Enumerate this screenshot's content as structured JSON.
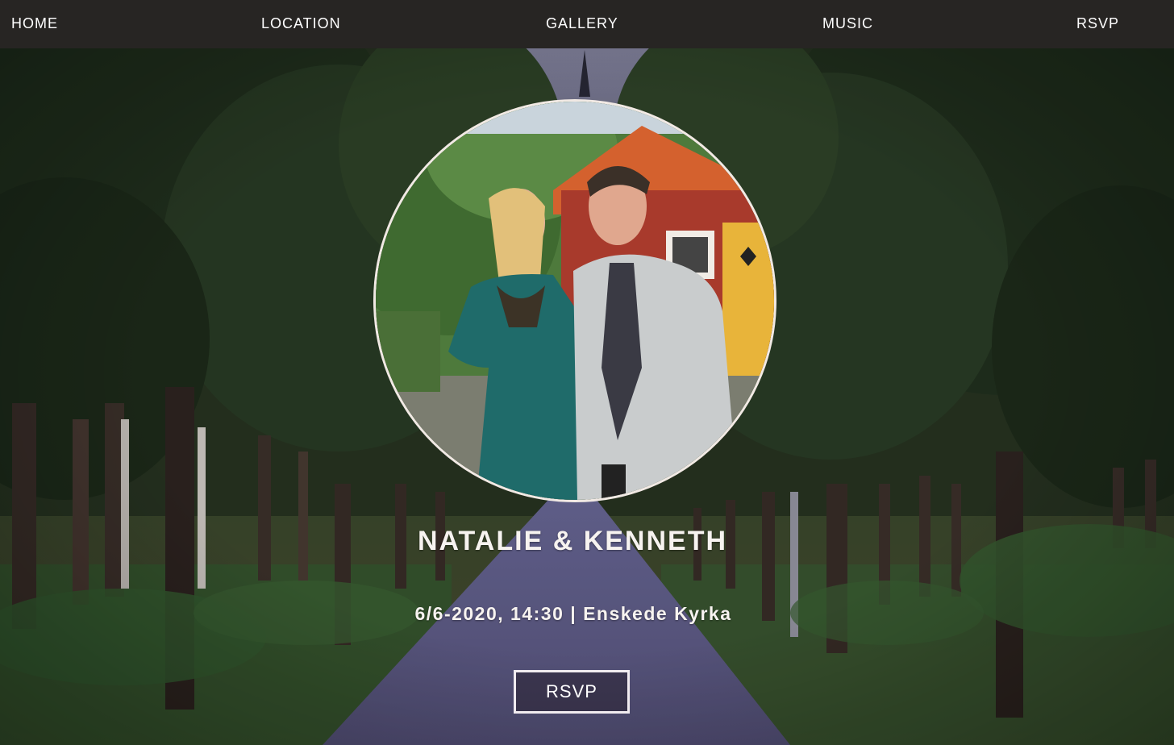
{
  "nav": {
    "items": [
      {
        "label": "HOME"
      },
      {
        "label": "LOCATION"
      },
      {
        "label": "GALLERY"
      },
      {
        "label": "MUSIC"
      },
      {
        "label": "RSVP"
      }
    ]
  },
  "hero": {
    "title": "NATALIE & KENNETH",
    "details": "6/6-2020, 14:30 | Enskede Kyrka",
    "rsvp_label": "RSVP"
  },
  "colors": {
    "nav_background": "#272523",
    "text": "#ffffff",
    "photo_border": "#f1e9e4"
  }
}
